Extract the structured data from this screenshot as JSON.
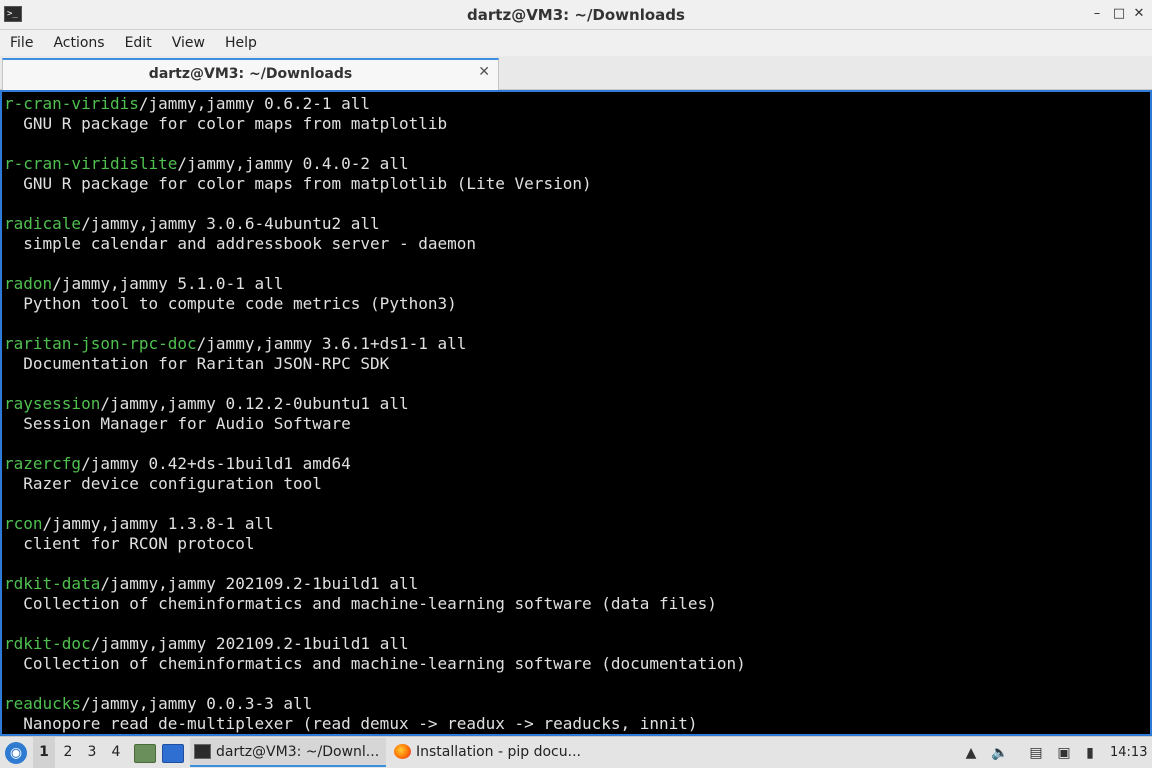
{
  "window": {
    "title": "dartz@VM3: ~/Downloads",
    "controls": {
      "minimize": "–",
      "maximize": "□",
      "close": "✕"
    }
  },
  "menu": [
    "File",
    "Actions",
    "Edit",
    "View",
    "Help"
  ],
  "tab": {
    "label": "dartz@VM3: ~/Downloads",
    "close": "✕"
  },
  "terminal": {
    "lines": [
      {
        "pkg": "r-cran-viridis",
        "rest": "/jammy,jammy 0.6.2-1 all"
      },
      {
        "pkg": "",
        "rest": "  GNU R package for color maps from matplotlib"
      },
      {
        "pkg": "",
        "rest": ""
      },
      {
        "pkg": "r-cran-viridislite",
        "rest": "/jammy,jammy 0.4.0-2 all"
      },
      {
        "pkg": "",
        "rest": "  GNU R package for color maps from matplotlib (Lite Version)"
      },
      {
        "pkg": "",
        "rest": ""
      },
      {
        "pkg": "radicale",
        "rest": "/jammy,jammy 3.0.6-4ubuntu2 all"
      },
      {
        "pkg": "",
        "rest": "  simple calendar and addressbook server - daemon"
      },
      {
        "pkg": "",
        "rest": ""
      },
      {
        "pkg": "radon",
        "rest": "/jammy,jammy 5.1.0-1 all"
      },
      {
        "pkg": "",
        "rest": "  Python tool to compute code metrics (Python3)"
      },
      {
        "pkg": "",
        "rest": ""
      },
      {
        "pkg": "raritan-json-rpc-doc",
        "rest": "/jammy,jammy 3.6.1+ds1-1 all"
      },
      {
        "pkg": "",
        "rest": "  Documentation for Raritan JSON-RPC SDK"
      },
      {
        "pkg": "",
        "rest": ""
      },
      {
        "pkg": "raysession",
        "rest": "/jammy,jammy 0.12.2-0ubuntu1 all"
      },
      {
        "pkg": "",
        "rest": "  Session Manager for Audio Software"
      },
      {
        "pkg": "",
        "rest": ""
      },
      {
        "pkg": "razercfg",
        "rest": "/jammy 0.42+ds-1build1 amd64"
      },
      {
        "pkg": "",
        "rest": "  Razer device configuration tool"
      },
      {
        "pkg": "",
        "rest": ""
      },
      {
        "pkg": "rcon",
        "rest": "/jammy,jammy 1.3.8-1 all"
      },
      {
        "pkg": "",
        "rest": "  client for RCON protocol"
      },
      {
        "pkg": "",
        "rest": ""
      },
      {
        "pkg": "rdkit-data",
        "rest": "/jammy,jammy 202109.2-1build1 all"
      },
      {
        "pkg": "",
        "rest": "  Collection of cheminformatics and machine-learning software (data files)"
      },
      {
        "pkg": "",
        "rest": ""
      },
      {
        "pkg": "rdkit-doc",
        "rest": "/jammy,jammy 202109.2-1build1 all"
      },
      {
        "pkg": "",
        "rest": "  Collection of cheminformatics and machine-learning software (documentation)"
      },
      {
        "pkg": "",
        "rest": ""
      },
      {
        "pkg": "readucks",
        "rest": "/jammy,jammy 0.0.3-3 all"
      },
      {
        "pkg": "",
        "rest": "  Nanopore read de-multiplexer (read demux -> readux -> readucks, innit)"
      }
    ],
    "colors": {
      "background": "#000000",
      "text": "#e0e0e0",
      "package": "#4fc04f",
      "border": "#2f7ad6"
    }
  },
  "taskbar": {
    "workspaces": [
      "1",
      "2",
      "3",
      "4"
    ],
    "active_workspace": "1",
    "tasks": [
      {
        "label": "dartz@VM3: ~/Downl...",
        "icon": "terminal-icon",
        "active": true
      },
      {
        "label": "Installation - pip docu...",
        "icon": "firefox-icon",
        "active": false
      }
    ],
    "clock": "14:13"
  }
}
